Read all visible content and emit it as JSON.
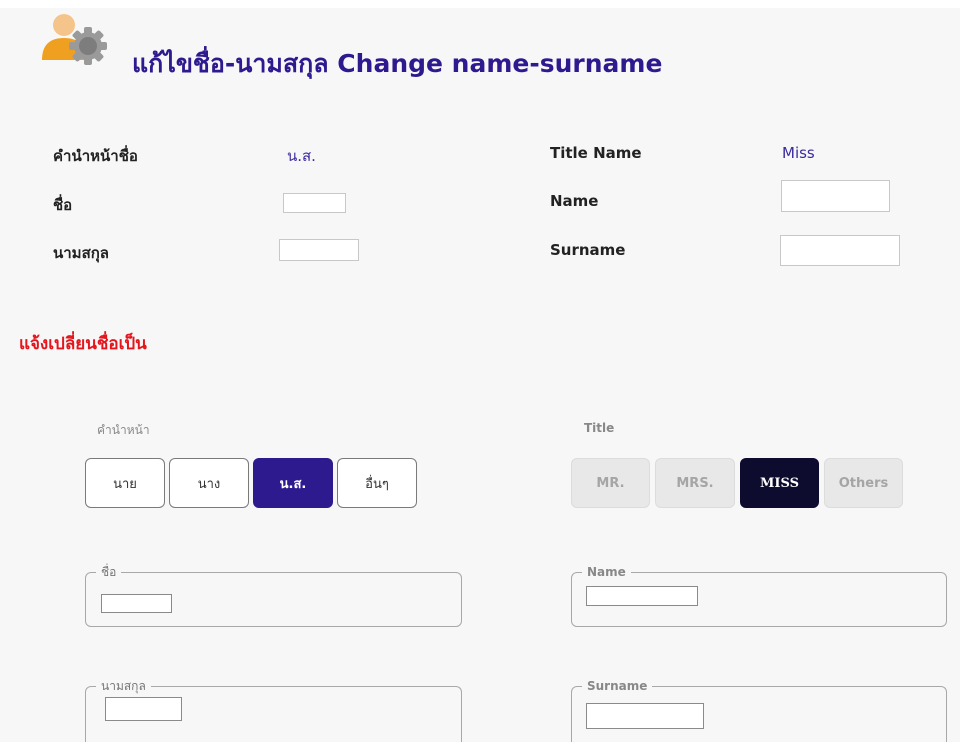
{
  "header": {
    "icon": "user-settings-icon",
    "title": "แก้ไขชื่อ-นามสกุล Change name-surname"
  },
  "current_info": {
    "thai": {
      "title_label": "คำนำหน้าชื่อ",
      "title_value": "น.ส.",
      "name_label": "ชื่อ",
      "name_value": "",
      "surname_label": "นามสกุล",
      "surname_value": ""
    },
    "english": {
      "title_label": "Title Name",
      "title_value": "Miss",
      "name_label": "Name",
      "name_value": "",
      "surname_label": "Surname",
      "surname_value": ""
    }
  },
  "change_notice": "แจ้งเปลี่ยนชื่อเป็น",
  "thai_title_group": {
    "label": "คำนำหน้า",
    "options": [
      "นาย",
      "นาง",
      "น.ส.",
      "อื่นๆ"
    ],
    "selected": "น.ส."
  },
  "english_title_group": {
    "label": "Title",
    "options": [
      "MR.",
      "MRS.",
      "MISS",
      "Others"
    ],
    "selected": "MISS"
  },
  "new_name_form": {
    "thai_name": {
      "legend": "ชื่อ",
      "value": ""
    },
    "thai_surname": {
      "legend": "นามสกุล",
      "value": ""
    },
    "en_name": {
      "legend": "Name",
      "value": ""
    },
    "en_surname": {
      "legend": "Surname",
      "value": ""
    }
  },
  "colors": {
    "accent": "#2d1a8f",
    "selected_en": "#0d0b2e",
    "notice": "#e4151d",
    "background": "#f7f7f7"
  }
}
